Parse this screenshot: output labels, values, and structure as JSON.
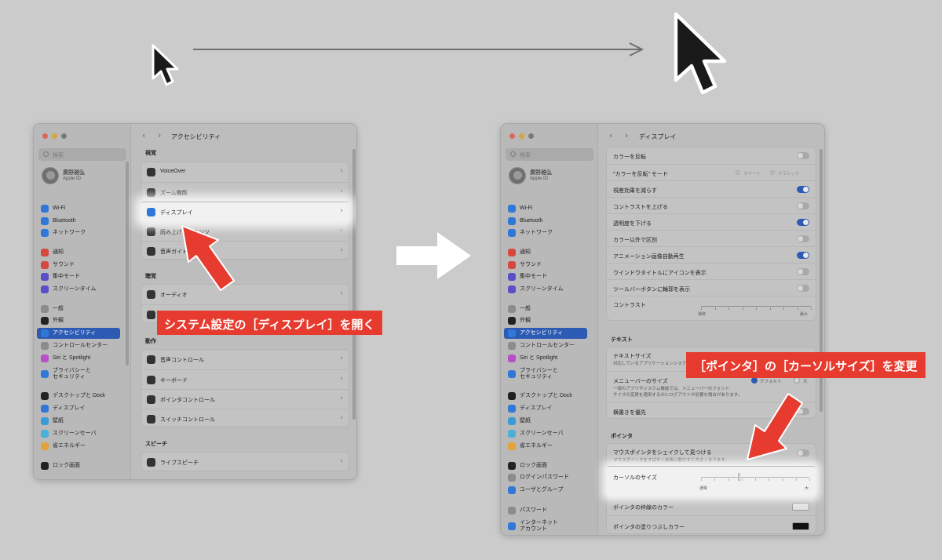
{
  "colors": {
    "background": "#cbcbcb",
    "accent": "#2d5bb3",
    "callout": "#e63b2e",
    "traffic_red": "#d9675e",
    "traffic_yellow": "#d6a53f",
    "traffic_green": "#7a7a7a"
  },
  "sidebar": {
    "search_placeholder": "検索",
    "profile_name": "廣野雅弘",
    "profile_sub": "Apple ID",
    "items": [
      {
        "label": "Wi-Fi",
        "icon": "wifi-icon",
        "color": "#2f78d8"
      },
      {
        "label": "Bluetooth",
        "icon": "bluetooth-icon",
        "color": "#2f78d8"
      },
      {
        "label": "ネットワーク",
        "icon": "globe-icon",
        "color": "#2f78d8"
      },
      {
        "label": "通知",
        "icon": "bell-icon",
        "color": "#d4483f"
      },
      {
        "label": "サウンド",
        "icon": "speaker-icon",
        "color": "#d4483f"
      },
      {
        "label": "集中モード",
        "icon": "moon-icon",
        "color": "#5b4ec9"
      },
      {
        "label": "スクリーンタイム",
        "icon": "hourglass-icon",
        "color": "#5b4ec9"
      },
      {
        "label": "一般",
        "icon": "gear-icon",
        "color": "#8c8c8c"
      },
      {
        "label": "外観",
        "icon": "appearance-icon",
        "color": "#222222"
      },
      {
        "label": "アクセシビリティ",
        "icon": "accessibility-icon",
        "color": "#2f78d8"
      },
      {
        "label": "コントロールセンター",
        "icon": "control-center-icon",
        "color": "#8c8c8c"
      },
      {
        "label": "Siri と Spotlight",
        "icon": "siri-icon",
        "color": "#b84fc8"
      },
      {
        "label": "プライバシーと\nセキュリティ",
        "icon": "hand-icon",
        "color": "#2f78d8"
      },
      {
        "label": "デスクトップと Dock",
        "icon": "dock-icon",
        "color": "#222222"
      },
      {
        "label": "ディスプレイ",
        "icon": "display-icon",
        "color": "#2f78d8"
      },
      {
        "label": "壁紙",
        "icon": "wallpaper-icon",
        "color": "#3a9bd8"
      },
      {
        "label": "スクリーンセーバ",
        "icon": "screensaver-icon",
        "color": "#4bb0d8"
      },
      {
        "label": "省エネルギー",
        "icon": "battery-icon",
        "color": "#e3a33a"
      },
      {
        "label": "ロック画面",
        "icon": "lock-icon",
        "color": "#222222"
      },
      {
        "label": "ログインパスワード",
        "icon": "password-icon",
        "color": "#8c8c8c"
      },
      {
        "label": "ユーザとグループ",
        "icon": "users-icon",
        "color": "#2f78d8"
      },
      {
        "label": "パスワード",
        "icon": "key-icon",
        "color": "#8c8c8c"
      },
      {
        "label": "インターネット\nアカウント",
        "icon": "at-icon",
        "color": "#2f78d8"
      }
    ]
  },
  "left_window": {
    "title": "アクセシビリティ",
    "sections": [
      {
        "heading": "視覚",
        "rows": [
          {
            "label": "VoiceOver",
            "icon": "voiceover-icon"
          },
          {
            "label": "ズーム機能",
            "icon": "zoom-icon"
          },
          {
            "label": "ディスプレイ",
            "icon": "display-icon",
            "highlight": true
          },
          {
            "label": "読み上げコンテンツ",
            "icon": "speech-bubble-icon"
          },
          {
            "label": "音声ガイド",
            "icon": "audio-description-icon"
          }
        ]
      },
      {
        "heading": "聴覚",
        "rows": [
          {
            "label": "オーディオ",
            "icon": "speaker-icon"
          },
          {
            "label": "字幕",
            "icon": "captions-icon"
          }
        ]
      },
      {
        "heading": "動作",
        "rows": [
          {
            "label": "音声コントロール",
            "icon": "voice-control-icon"
          },
          {
            "label": "キーボード",
            "icon": "keyboard-icon"
          },
          {
            "label": "ポインタコントロール",
            "icon": "pointer-icon"
          },
          {
            "label": "スイッチコントロール",
            "icon": "switch-icon"
          }
        ]
      },
      {
        "heading": "スピーチ",
        "rows": [
          {
            "label": "ライブスピーチ",
            "icon": "keyboard-icon"
          }
        ]
      }
    ],
    "callout": "システム設定の［ディスプレイ］を開く"
  },
  "right_window": {
    "title": "ディスプレイ",
    "rows": [
      {
        "label": "カラーを反転",
        "type": "toggle",
        "on": false
      },
      {
        "label": "\"カラーを反転\" モード",
        "type": "radio",
        "options": [
          "スマート",
          "クラシック"
        ]
      },
      {
        "label": "視差効果を減らす",
        "type": "toggle",
        "on": true
      },
      {
        "label": "コントラストを上げる",
        "type": "toggle",
        "on": false
      },
      {
        "label": "透明度を下げる",
        "type": "toggle",
        "on": true
      },
      {
        "label": "カラー以外で区別",
        "type": "toggle",
        "on": false
      },
      {
        "label": "アニメーション画像自動再生",
        "type": "toggle",
        "on": true
      },
      {
        "label": "ウインドウタイトルにアイコンを表示",
        "type": "toggle",
        "on": false
      },
      {
        "label": "ツールバーボタンに輪郭を表示",
        "type": "toggle",
        "on": false
      }
    ],
    "contrast": {
      "label": "コントラスト",
      "min": "通常",
      "max": "最大"
    },
    "text_heading": "テキスト",
    "text_size": {
      "label": "テキストサイズ",
      "sub": "対応しているアプリケーションシステム…"
    },
    "menubar": {
      "label": "メニューバーのサイズ",
      "sub1": "一部のアプリやシステム機能では、メニューバーのフォント",
      "sub2": "サイズの変更を適用するのにログアウトが必要な場合があります。",
      "opt_default": "デフォルト",
      "opt_large": "大"
    },
    "vertical": {
      "label": "横書きを優先"
    },
    "pointer_heading": "ポインタ",
    "shake": {
      "label": "マウスポインタをシェイクして見つける",
      "sub": "マウスポインタをすばやく前後に動かすと大きくなります。"
    },
    "cursor_size": {
      "label": "カーソルのサイズ",
      "min": "通常",
      "max": "大",
      "value": 0.35
    },
    "outline_color": {
      "label": "ポインタの枠線のカラー",
      "color": "#e2e2e2"
    },
    "fill_color": {
      "label": "ポインタの塗りつぶしカラー",
      "color": "#111111"
    },
    "callout": "［ポインタ］の［カーソルサイズ］を変更"
  }
}
